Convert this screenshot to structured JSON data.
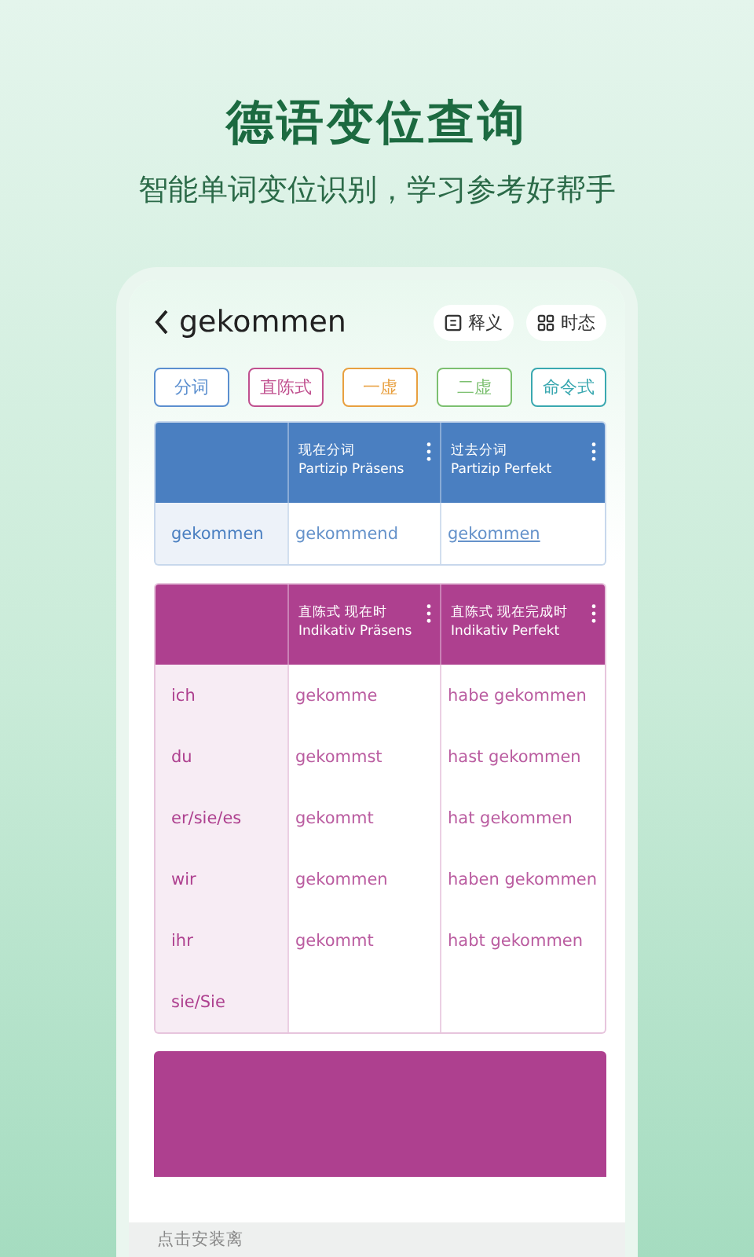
{
  "headline": "德语变位查询",
  "subheadline": "智能单词变位识别，学习参考好帮手",
  "app": {
    "word": "gekommen",
    "actions": [
      {
        "label": "释义",
        "kind": "list"
      },
      {
        "label": "时态",
        "kind": "grid"
      }
    ],
    "mood_tabs": [
      {
        "label": "分词",
        "color": "#5b8fcf"
      },
      {
        "label": "直陈式",
        "color": "#c0508f"
      },
      {
        "label": "一虚",
        "color": "#e8a040"
      },
      {
        "label": "二虚",
        "color": "#7cc070"
      },
      {
        "label": "命令式",
        "color": "#3aa8b0"
      }
    ],
    "tables": [
      {
        "color": "#4a7fc1",
        "columns": [
          {
            "zh": "现在分词",
            "de": "Partizip Präsens"
          },
          {
            "zh": "过去分词",
            "de": "Partizip Perfekt"
          }
        ],
        "rows": [
          {
            "label": "gekommen",
            "cells": [
              {
                "text": "gekommend",
                "link": false
              },
              {
                "text": "gekommen",
                "link": true
              }
            ]
          }
        ]
      },
      {
        "color": "#ae408f",
        "columns": [
          {
            "zh": "直陈式 现在时",
            "de": "Indikativ Präsens"
          },
          {
            "zh": "直陈式 现在完成时",
            "de": "Indikativ Perfekt"
          }
        ],
        "rows": [
          {
            "label": "ich",
            "cells": [
              {
                "text": "gekomme",
                "link": false
              },
              {
                "text": "habe gekommen",
                "link": false
              }
            ]
          },
          {
            "label": "du",
            "cells": [
              {
                "text": "gekommst",
                "link": false
              },
              {
                "text": "hast gekommen",
                "link": false
              }
            ]
          },
          {
            "label": "er/sie/es",
            "cells": [
              {
                "text": "gekommt",
                "link": false
              },
              {
                "text": "hat gekommen",
                "link": false
              }
            ]
          },
          {
            "label": "wir",
            "cells": [
              {
                "text": "gekommen",
                "link": false
              },
              {
                "text": "haben gekommen",
                "link": false
              }
            ]
          },
          {
            "label": "ihr",
            "cells": [
              {
                "text": "gekommt",
                "link": false
              },
              {
                "text": "habt gekommen",
                "link": false
              }
            ]
          },
          {
            "label": "sie/Sie",
            "cells": []
          }
        ]
      }
    ],
    "next_table": {
      "color": "#ae408f"
    },
    "install_hint": "点击安装离"
  }
}
